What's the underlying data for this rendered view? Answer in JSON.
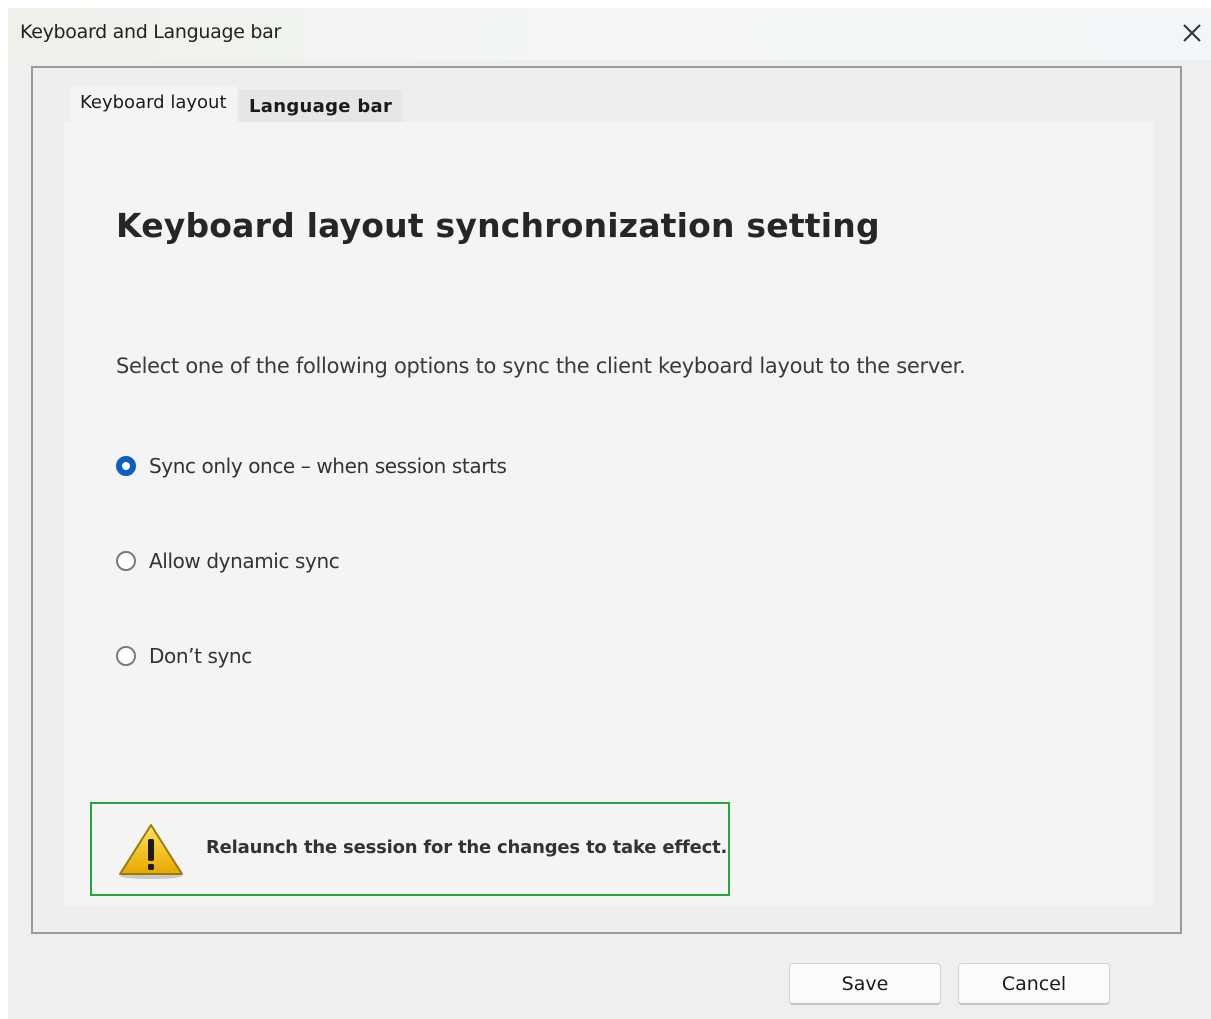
{
  "window": {
    "title": "Keyboard and Language bar",
    "close_icon": "close-icon"
  },
  "tabs": [
    {
      "label": "Keyboard layout",
      "active": true
    },
    {
      "label": "Language bar",
      "active": false
    }
  ],
  "panel": {
    "heading": "Keyboard layout synchronization setting",
    "description": "Select one of the following options to sync the client keyboard layout to the server.",
    "options": [
      {
        "label": "Sync only once – when session starts",
        "selected": true
      },
      {
        "label": "Allow dynamic sync",
        "selected": false
      },
      {
        "label": "Don’t sync",
        "selected": false
      }
    ],
    "notice": {
      "icon": "warning-icon",
      "text": "Relaunch the session for the changes to take effect.",
      "border_color": "#22a83a"
    }
  },
  "buttons": {
    "save_label": "Save",
    "cancel_label": "Cancel"
  },
  "colors": {
    "accent": "#0f5fc2",
    "notice_border": "#22a83a",
    "warning_yellow": "#f2c20f"
  }
}
